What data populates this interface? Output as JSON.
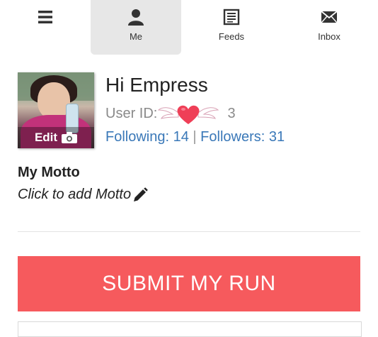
{
  "nav": {
    "menu_label": "",
    "tabs": [
      {
        "label": "Me",
        "icon": "person-icon",
        "active": true
      },
      {
        "label": "Feeds",
        "icon": "newspaper-icon",
        "active": false
      },
      {
        "label": "Inbox",
        "icon": "envelope-icon",
        "active": false
      }
    ]
  },
  "profile": {
    "greeting": "Hi Empress",
    "user_id_label": "User ID:",
    "user_id_tail": "3",
    "avatar_edit_label": "Edit",
    "following_label": "Following: 14",
    "separator": "|",
    "followers_label": "Followers: 31"
  },
  "motto": {
    "title": "My Motto",
    "placeholder": "Click to add Motto"
  },
  "actions": {
    "submit_label": "SUBMIT MY RUN"
  },
  "colors": {
    "accent": "#f65a5d",
    "link": "#3a78b8",
    "active_tab_bg": "#e7e7e7"
  }
}
